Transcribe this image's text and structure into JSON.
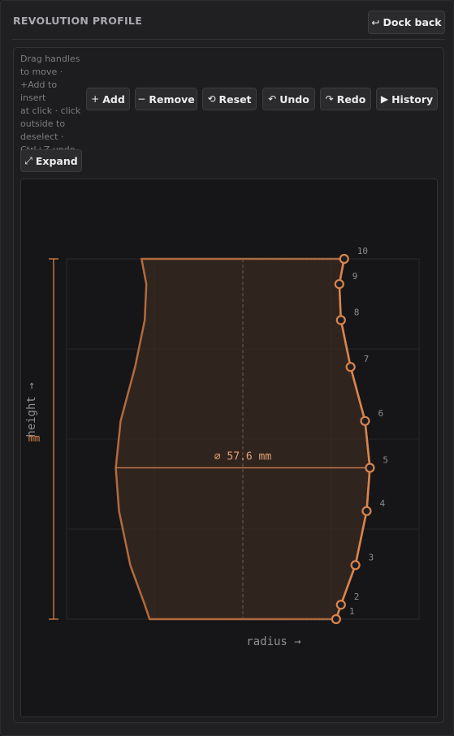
{
  "panel": {
    "title": "REVOLUTION PROFILE",
    "dock_label": "Dock back",
    "dock_icon": "dock-icon"
  },
  "hint": {
    "lines": [
      "Drag handles",
      "to move ·",
      "+Add to insert",
      "at click · click",
      "outside to",
      "deselect ·",
      "Ctrl+Z undo"
    ]
  },
  "toolbar": {
    "add": {
      "icon": "+",
      "label": "Add"
    },
    "remove": {
      "icon": "−",
      "label": "Remove"
    },
    "reset": {
      "icon": "⟲",
      "label": "Reset"
    },
    "undo": {
      "icon": "↶",
      "label": "Undo"
    },
    "redo": {
      "icon": "↷",
      "label": "Redo"
    },
    "history": {
      "icon": "▶",
      "label": "History"
    },
    "expand": {
      "icon": "⤢",
      "label": "Expand"
    }
  },
  "chart_data": {
    "type": "line",
    "xlabel": "radius →",
    "ylabel": "height →",
    "yunit": "mm",
    "diameter_label": "⌀ 57.6 mm",
    "accent": "#d9854e",
    "points": [
      {
        "id": "1",
        "radius": 0.58,
        "height": 0.0
      },
      {
        "id": "2",
        "radius": 0.61,
        "height": 0.04
      },
      {
        "id": "3",
        "radius": 0.7,
        "height": 0.15
      },
      {
        "id": "4",
        "radius": 0.77,
        "height": 0.3
      },
      {
        "id": "5",
        "radius": 0.79,
        "height": 0.42
      },
      {
        "id": "6",
        "radius": 0.76,
        "height": 0.55
      },
      {
        "id": "7",
        "radius": 0.67,
        "height": 0.7
      },
      {
        "id": "8",
        "radius": 0.61,
        "height": 0.83
      },
      {
        "id": "9",
        "radius": 0.6,
        "height": 0.93
      },
      {
        "id": "10",
        "radius": 0.63,
        "height": 1.0
      }
    ],
    "max_diameter_point": "5"
  }
}
